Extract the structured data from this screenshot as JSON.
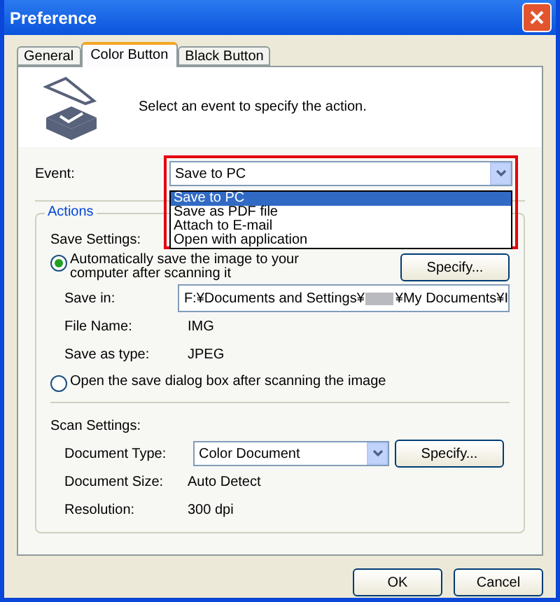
{
  "window": {
    "title": "Preference"
  },
  "tabs": [
    {
      "label": "General",
      "selected": false
    },
    {
      "label": "Color Button",
      "selected": true
    },
    {
      "label": "Black Button",
      "selected": false
    }
  ],
  "header": {
    "text": "Select an event to specify the action."
  },
  "event": {
    "label": "Event:",
    "value": "Save to PC",
    "options": [
      {
        "label": "Save to PC",
        "selected": true
      },
      {
        "label": "Save as PDF file",
        "selected": false
      },
      {
        "label": "Attach to E-mail",
        "selected": false
      },
      {
        "label": "Open with application",
        "selected": false
      }
    ]
  },
  "actions": {
    "title": "Actions",
    "save_settings": "Save Settings:",
    "radios": [
      {
        "label": "Automatically save the image to your computer after scanning it",
        "selected": true
      },
      {
        "label": "Open the save dialog box after scanning the image",
        "selected": false
      }
    ],
    "specify": "Specify...",
    "save_in": {
      "label": "Save in:",
      "value_start": "F:¥Documents and Settings¥",
      "value_end": "¥My Documents¥I"
    },
    "file_name": {
      "label": "File Name:",
      "value": "IMG"
    },
    "save_as_type": {
      "label": "Save as type:",
      "value": "JPEG"
    },
    "scan_settings": "Scan Settings:",
    "document_type": {
      "label": "Document Type:",
      "value": "Color Document"
    },
    "scan_specify": "Specify...",
    "document_size": {
      "label": "Document Size:",
      "value": "Auto Detect"
    },
    "resolution": {
      "label": "Resolution:",
      "value": "300 dpi"
    }
  },
  "buttons": [
    "OK",
    "Cancel"
  ]
}
